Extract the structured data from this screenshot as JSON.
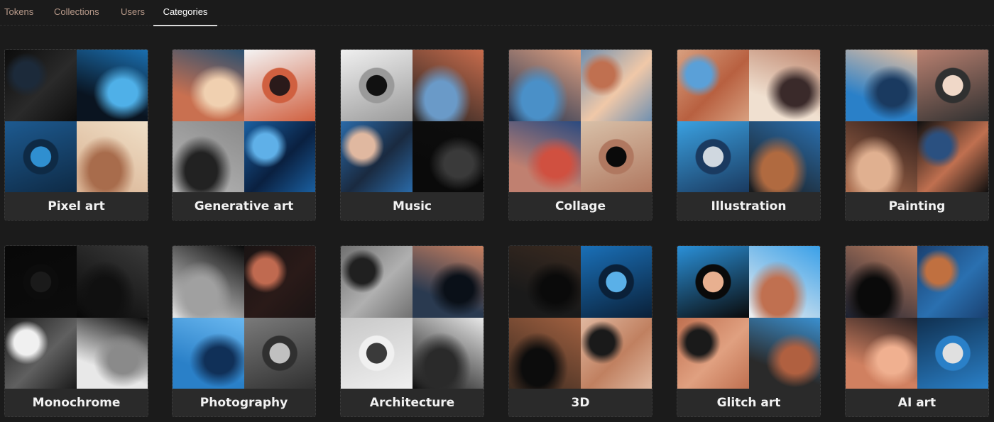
{
  "tabs": [
    {
      "label": "Tokens",
      "active": false
    },
    {
      "label": "Collections",
      "active": false
    },
    {
      "label": "Users",
      "active": false
    },
    {
      "label": "Categories",
      "active": true
    }
  ],
  "categories": [
    {
      "name": "Pixel art",
      "tiles": [
        [
          "#0c0c0c",
          "#1c2a3a",
          "#2a2a2a"
        ],
        [
          "#0a1420",
          "#1a6fb0",
          "#4fb0e8"
        ],
        [
          "#1d5a90",
          "#2f8fd0",
          "#0e2a45"
        ],
        [
          "#d8b090",
          "#f0e0c8",
          "#a86c4c"
        ]
      ]
    },
    {
      "name": "Generative art",
      "tiles": [
        [
          "#c97050",
          "#2a5070",
          "#f0d0b0"
        ],
        [
          "#f4f4f4",
          "#2a1a1a",
          "#d06040"
        ],
        [
          "#b8b8b8",
          "#8a8a8a",
          "#222222"
        ],
        [
          "#1a5fa0",
          "#5fb0e8",
          "#0a2040"
        ]
      ]
    },
    {
      "name": "Music",
      "tiles": [
        [
          "#f0f0f0",
          "#111111",
          "#9a9a9a"
        ],
        [
          "#202020",
          "#c86c4c",
          "#6a9ac8"
        ],
        [
          "#2a6aa8",
          "#e0b8a0",
          "#1a2a40"
        ],
        [
          "#0a0a0a",
          "#0e0e0e",
          "#3a3a3a"
        ]
      ]
    },
    {
      "name": "Collage",
      "tiles": [
        [
          "#1a3050",
          "#e0a080",
          "#4a90c8"
        ],
        [
          "#7090b0",
          "#c07050",
          "#f0c8a8"
        ],
        [
          "#c08070",
          "#2a4a80",
          "#d05040"
        ],
        [
          "#d8c0a8",
          "#0a0a0a",
          "#b07860"
        ]
      ]
    },
    {
      "name": "Illustration",
      "tiles": [
        [
          "#d8a080",
          "#5aa0d8",
          "#b86040"
        ],
        [
          "#f0e0d0",
          "#c08870",
          "#3a2a2a"
        ],
        [
          "#3aa0e0",
          "#d0d8e0",
          "#1a3a60"
        ],
        [
          "#1a1a1a",
          "#2a70b0",
          "#b06a40"
        ]
      ]
    },
    {
      "name": "Painting",
      "tiles": [
        [
          "#2a80c8",
          "#e8c0a0",
          "#1a3a60"
        ],
        [
          "#b88070",
          "#f0d8c8",
          "#303030"
        ],
        [
          "#b07050",
          "#2a1a18",
          "#e0b090"
        ],
        [
          "#101010",
          "#2a5080",
          "#c07050"
        ]
      ]
    },
    {
      "name": "Monochrome",
      "tiles": [
        [
          "#080808",
          "#1a1a1a",
          "#0c0c0c"
        ],
        [
          "#070707",
          "#3a3a3a",
          "#101010"
        ],
        [
          "#1a1a1a",
          "#f0f0f0",
          "#606060"
        ],
        [
          "#e8e8e8",
          "#0a0a0a",
          "#8a8a8a"
        ]
      ]
    },
    {
      "name": "Photography",
      "tiles": [
        [
          "#e8e8e8",
          "#0a0a0a",
          "#a0a0a0"
        ],
        [
          "#1a1414",
          "#c06a50",
          "#2a1a18"
        ],
        [
          "#2a80c8",
          "#6ab8f0",
          "#103058"
        ],
        [
          "#7a7a7a",
          "#c0c0c0",
          "#303030"
        ]
      ]
    },
    {
      "name": "Architecture",
      "tiles": [
        [
          "#707070",
          "#202020",
          "#b0b0b0"
        ],
        [
          "#2a3a50",
          "#c88060",
          "#0a1018"
        ],
        [
          "#c8c8c8",
          "#3a3a3a",
          "#f0f0f0"
        ],
        [
          "#0e0e0e",
          "#e8e8e8",
          "#2a2a2a"
        ]
      ]
    },
    {
      "name": "3D",
      "tiles": [
        [
          "#1a1a1a",
          "#3a2a20",
          "#0a0a0a"
        ],
        [
          "#1a70b8",
          "#5ab0e8",
          "#0a2038"
        ],
        [
          "#3a2a20",
          "#a06040",
          "#0c0c0c"
        ],
        [
          "#e0b8a0",
          "#1a1a1a",
          "#c08060"
        ]
      ]
    },
    {
      "name": "Glitch art",
      "tiles": [
        [
          "#2a90d8",
          "#e8b090",
          "#0a0a0a"
        ],
        [
          "#f0f0f0",
          "#3aa0e8",
          "#c07050"
        ],
        [
          "#c07050",
          "#1a1a1a",
          "#e0a080"
        ],
        [
          "#2a2a2a",
          "#3a90d0",
          "#b06040"
        ]
      ]
    },
    {
      "name": "AI art",
      "tiles": [
        [
          "#1a2030",
          "#c08060",
          "#0a0a0a"
        ],
        [
          "#1a4070",
          "#c07040",
          "#2a70b0"
        ],
        [
          "#d08060",
          "#2a2020",
          "#f0b090"
        ],
        [
          "#103050",
          "#e0e0e0",
          "#2a80c8"
        ]
      ]
    }
  ]
}
